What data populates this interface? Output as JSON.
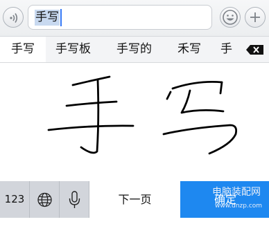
{
  "input": {
    "value": "手写"
  },
  "candidates": [
    "手写",
    "手写板",
    "手写的",
    "禾写",
    "手"
  ],
  "pad": {
    "strokes_text": "手写"
  },
  "bottom": {
    "num_key": "123",
    "next_page": "下一页",
    "send_label": "确定",
    "watermark_line1": "电脑装配网",
    "watermark_line2": "www.dnzp.com"
  },
  "icons": {
    "voice": "voice-input-icon",
    "emoji": "emoji-icon",
    "plus": "plus-icon",
    "delete": "delete-backspace-icon",
    "globe": "globe-icon",
    "mic": "microphone-icon"
  },
  "colors": {
    "send_key": "#1e88f0",
    "selection": "#c8d9f0",
    "caret": "#3478f6"
  }
}
